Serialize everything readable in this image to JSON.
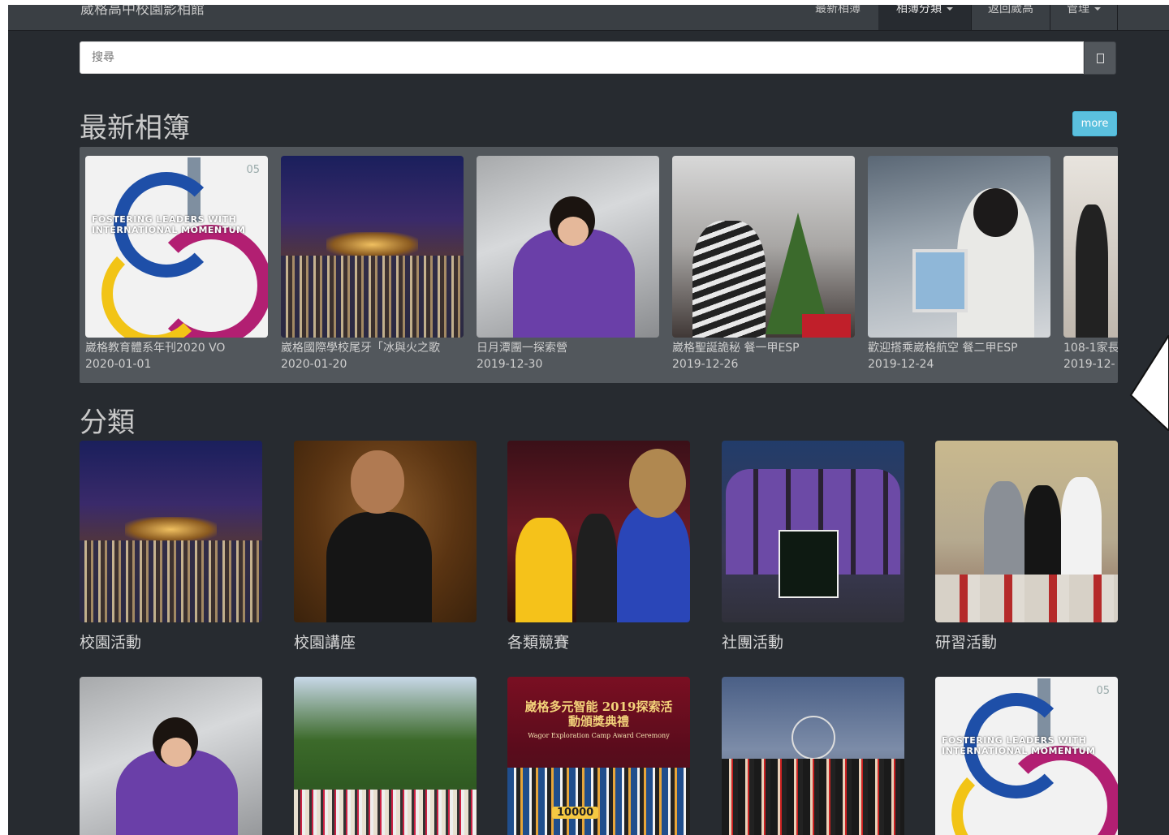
{
  "navbar": {
    "brand": "崴格高中校園影相館",
    "items": [
      {
        "label": "最新相簿",
        "caret": false
      },
      {
        "label": "相簿分類",
        "caret": true
      },
      {
        "label": "返回崴高",
        "caret": false
      },
      {
        "label": "管理",
        "caret": true
      }
    ]
  },
  "search": {
    "placeholder": "搜尋",
    "button_icon": "search-icon"
  },
  "latest": {
    "title": "最新相簿",
    "more_label": "more",
    "albums": [
      {
        "title": "崴格教育體系年刊2020 VO",
        "date": "2020-01-01"
      },
      {
        "title": "崴格國際學校尾牙「冰與火之歌",
        "date": "2020-01-20"
      },
      {
        "title": "日月潭團一探索營",
        "date": "2019-12-30"
      },
      {
        "title": "崴格聖誕詭秘 餐一甲ESP",
        "date": "2019-12-26"
      },
      {
        "title": "歡迎搭乘崴格航空 餐二甲ESP",
        "date": "2019-12-24"
      },
      {
        "title": "108-1家長",
        "date": "2019-12-"
      }
    ]
  },
  "poster": {
    "line1": "FOSTERING  LEADERS  WITH",
    "line2": "INTERNATIONAL  MOMENTUM",
    "vol": "05"
  },
  "award": {
    "title": "崴格多元智能 2019探索活動頒獎典禮",
    "subtitle": "Wagor Exploration Camp Award Ceremony",
    "amount": "10000"
  },
  "categories": {
    "title": "分類",
    "items": [
      {
        "label": "校園活動"
      },
      {
        "label": "校園講座"
      },
      {
        "label": "各類競賽"
      },
      {
        "label": "社團活動"
      },
      {
        "label": "研習活動"
      }
    ]
  }
}
